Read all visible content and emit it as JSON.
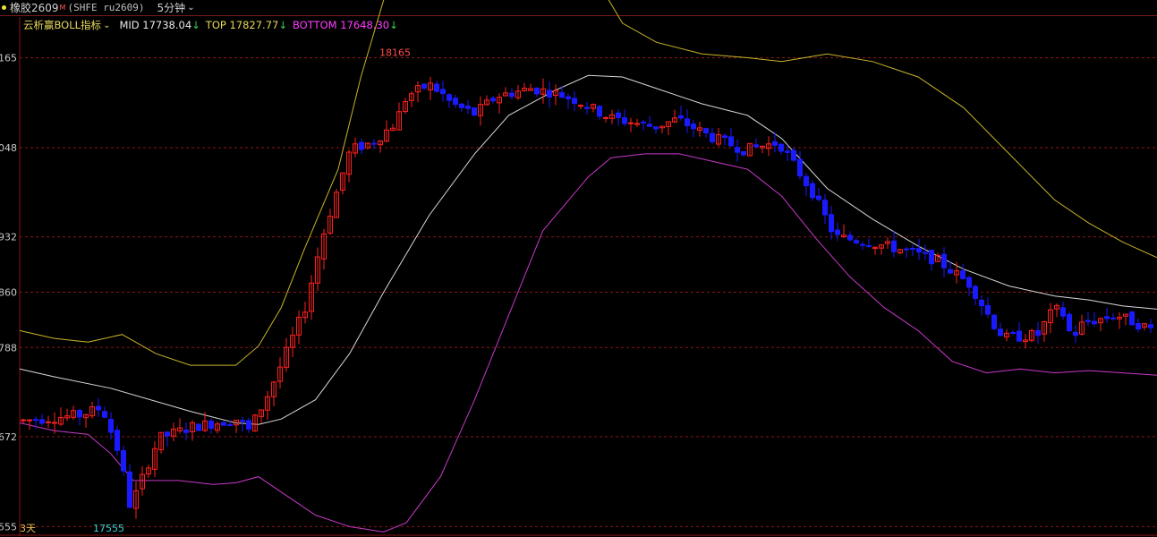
{
  "header": {
    "symbol": "橡胶2609",
    "superscript": "M",
    "code": "(SHFE ru2609)",
    "period": "5分钟",
    "dot_color": "#f0e040"
  },
  "indicator": {
    "title": "云析赢BOLL指标",
    "mid_label": "MID",
    "mid_value": "17738.04",
    "top_label": "TOP",
    "top_value": "17827.77",
    "bottom_label": "BOTTOM",
    "bottom_value": "17648.30",
    "arrow": "↓"
  },
  "chart_data": {
    "type": "candlestick",
    "y_axis": {
      "ylim": [
        17545,
        18218
      ],
      "ticks": [
        17555,
        17672,
        17788,
        17860,
        17932,
        18048,
        18165
      ],
      "tick_labels": [
        "555",
        "672",
        "788",
        "860",
        "932",
        "048",
        "165"
      ]
    },
    "annotations": {
      "high_label": "18165",
      "low_label": "17555",
      "range_label": "3天"
    },
    "colors": {
      "up": "#ff2020",
      "down": "#1a1aff",
      "mid": "#d8d8d8",
      "top": "#c8b428",
      "bottom": "#c838c8",
      "grid": "#8a1515"
    },
    "mid_line": [
      [
        0,
        17760
      ],
      [
        0.03,
        17750
      ],
      [
        0.08,
        17735
      ],
      [
        0.15,
        17705
      ],
      [
        0.19,
        17690
      ],
      [
        0.21,
        17688
      ],
      [
        0.23,
        17695
      ],
      [
        0.26,
        17720
      ],
      [
        0.29,
        17780
      ],
      [
        0.32,
        17860
      ],
      [
        0.36,
        17960
      ],
      [
        0.4,
        18040
      ],
      [
        0.43,
        18090
      ],
      [
        0.47,
        18122
      ],
      [
        0.5,
        18142
      ],
      [
        0.53,
        18140
      ],
      [
        0.56,
        18125
      ],
      [
        0.6,
        18105
      ],
      [
        0.64,
        18090
      ],
      [
        0.67,
        18060
      ],
      [
        0.71,
        17995
      ],
      [
        0.75,
        17955
      ],
      [
        0.79,
        17920
      ],
      [
        0.83,
        17890
      ],
      [
        0.87,
        17868
      ],
      [
        0.91,
        17855
      ],
      [
        0.94,
        17850
      ],
      [
        0.97,
        17842
      ],
      [
        1.0,
        17838
      ]
    ],
    "top_line": [
      [
        0,
        17810
      ],
      [
        0.03,
        17800
      ],
      [
        0.06,
        17795
      ],
      [
        0.09,
        17805
      ],
      [
        0.12,
        17780
      ],
      [
        0.15,
        17765
      ],
      [
        0.19,
        17765
      ],
      [
        0.21,
        17790
      ],
      [
        0.23,
        17840
      ],
      [
        0.25,
        17915
      ],
      [
        0.28,
        18020
      ],
      [
        0.3,
        18140
      ],
      [
        0.32,
        18240
      ],
      [
        0.36,
        18310
      ],
      [
        0.4,
        18340
      ],
      [
        0.44,
        18330
      ],
      [
        0.49,
        18310
      ],
      [
        0.51,
        18260
      ],
      [
        0.53,
        18210
      ],
      [
        0.56,
        18185
      ],
      [
        0.6,
        18170
      ],
      [
        0.64,
        18165
      ],
      [
        0.67,
        18160
      ],
      [
        0.71,
        18170
      ],
      [
        0.75,
        18160
      ],
      [
        0.79,
        18140
      ],
      [
        0.83,
        18100
      ],
      [
        0.87,
        18040
      ],
      [
        0.91,
        17980
      ],
      [
        0.94,
        17950
      ],
      [
        0.97,
        17925
      ],
      [
        1.0,
        17905
      ]
    ],
    "bottom_line": [
      [
        0,
        17690
      ],
      [
        0.03,
        17680
      ],
      [
        0.06,
        17675
      ],
      [
        0.08,
        17650
      ],
      [
        0.1,
        17615
      ],
      [
        0.14,
        17615
      ],
      [
        0.17,
        17610
      ],
      [
        0.19,
        17612
      ],
      [
        0.21,
        17620
      ],
      [
        0.23,
        17600
      ],
      [
        0.26,
        17570
      ],
      [
        0.29,
        17555
      ],
      [
        0.32,
        17548
      ],
      [
        0.34,
        17560
      ],
      [
        0.37,
        17620
      ],
      [
        0.4,
        17720
      ],
      [
        0.43,
        17830
      ],
      [
        0.46,
        17940
      ],
      [
        0.5,
        18010
      ],
      [
        0.52,
        18035
      ],
      [
        0.55,
        18040
      ],
      [
        0.58,
        18040
      ],
      [
        0.61,
        18030
      ],
      [
        0.64,
        18020
      ],
      [
        0.67,
        17985
      ],
      [
        0.7,
        17930
      ],
      [
        0.73,
        17880
      ],
      [
        0.76,
        17840
      ],
      [
        0.79,
        17810
      ],
      [
        0.82,
        17770
      ],
      [
        0.85,
        17755
      ],
      [
        0.88,
        17760
      ],
      [
        0.91,
        17755
      ],
      [
        0.94,
        17758
      ],
      [
        0.97,
        17755
      ],
      [
        1.0,
        17752
      ]
    ],
    "close_anchors": [
      [
        0,
        17693
      ],
      [
        0.05,
        17700
      ],
      [
        0.07,
        17710
      ],
      [
        0.085,
        17650
      ],
      [
        0.095,
        17580
      ],
      [
        0.12,
        17670
      ],
      [
        0.15,
        17685
      ],
      [
        0.17,
        17690
      ],
      [
        0.19,
        17695
      ],
      [
        0.2,
        17680
      ],
      [
        0.215,
        17720
      ],
      [
        0.23,
        17770
      ],
      [
        0.25,
        17840
      ],
      [
        0.265,
        17930
      ],
      [
        0.28,
        18000
      ],
      [
        0.29,
        18045
      ],
      [
        0.31,
        18055
      ],
      [
        0.33,
        18080
      ],
      [
        0.34,
        18115
      ],
      [
        0.36,
        18130
      ],
      [
        0.37,
        18120
      ],
      [
        0.38,
        18105
      ],
      [
        0.4,
        18092
      ],
      [
        0.42,
        18115
      ],
      [
        0.45,
        18125
      ],
      [
        0.47,
        18120
      ],
      [
        0.49,
        18110
      ],
      [
        0.52,
        18087
      ],
      [
        0.56,
        18075
      ],
      [
        0.58,
        18085
      ],
      [
        0.61,
        18062
      ],
      [
        0.64,
        18045
      ],
      [
        0.67,
        18055
      ],
      [
        0.7,
        17990
      ],
      [
        0.72,
        17932
      ],
      [
        0.75,
        17925
      ],
      [
        0.78,
        17915
      ],
      [
        0.81,
        17902
      ],
      [
        0.84,
        17870
      ],
      [
        0.86,
        17820
      ],
      [
        0.87,
        17800
      ],
      [
        0.9,
        17805
      ],
      [
        0.91,
        17830
      ],
      [
        0.92,
        17840
      ],
      [
        0.93,
        17800
      ],
      [
        0.94,
        17820
      ],
      [
        0.97,
        17830
      ],
      [
        1.0,
        17812
      ]
    ],
    "candle_count": 181
  }
}
